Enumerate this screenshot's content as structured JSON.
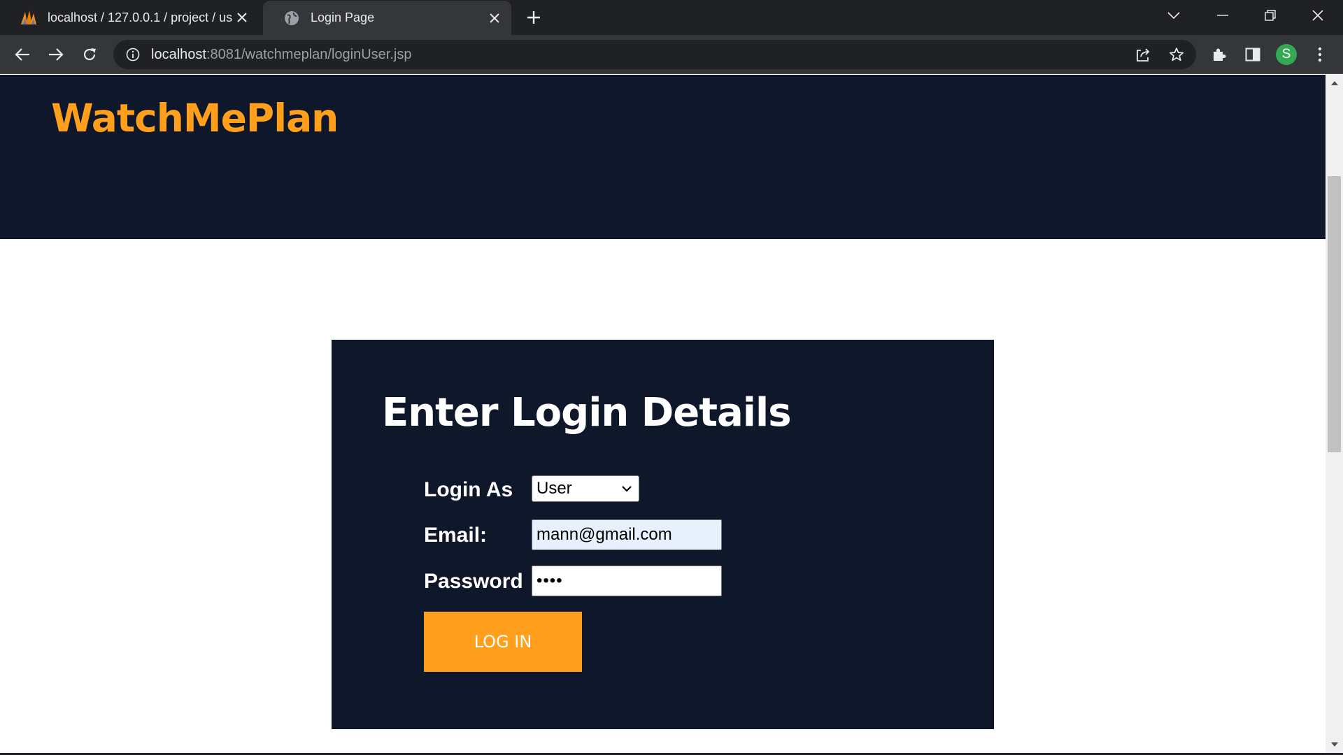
{
  "browser": {
    "tabs": [
      {
        "title": "localhost / 127.0.0.1 / project / us",
        "favicon": "phpmyadmin-icon",
        "active": false
      },
      {
        "title": "Login Page",
        "favicon": "globe-icon",
        "active": true
      }
    ],
    "url_host": "localhost",
    "url_rest": ":8081/watchmeplan/loginUser.jsp",
    "profile_initial": "S",
    "colors": {
      "chrome_dark": "#202124",
      "chrome_tab": "#35363a",
      "avatar": "#34a853"
    }
  },
  "page": {
    "brand": "WatchMePlan",
    "login": {
      "title": "Enter Login Details",
      "login_as_label": "Login As",
      "login_as_value": "User",
      "email_label": "Email:",
      "email_value": "mann@gmail.com",
      "password_label": "Password",
      "password_value": "••••",
      "button_label": "LOG IN"
    },
    "colors": {
      "navy": "#0f172a",
      "accent": "#ff9f1c",
      "autofill": "#e8f0fe"
    }
  }
}
